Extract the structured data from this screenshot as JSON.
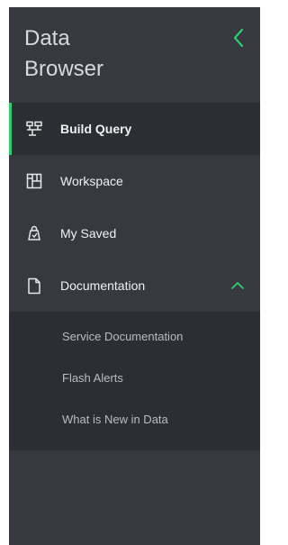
{
  "app": {
    "title": "Data Browser"
  },
  "colors": {
    "sidebar_bg": "#363a40",
    "active_bg": "#2b2e33",
    "accent": "#2ecc71"
  },
  "icons": {
    "collapse": "chevron-left-icon",
    "expand": "chevron-up-icon"
  },
  "nav": {
    "items": [
      {
        "label": "Build Query",
        "icon": "query-builder-icon",
        "active": true
      },
      {
        "label": "Workspace",
        "icon": "workspace-icon",
        "active": false
      },
      {
        "label": "My Saved",
        "icon": "saved-icon",
        "active": false
      },
      {
        "label": "Documentation",
        "icon": "document-icon",
        "active": false,
        "expanded": true
      }
    ],
    "submenu": [
      {
        "label": "Service Documentation"
      },
      {
        "label": "Flash Alerts"
      },
      {
        "label": "What is New in Data"
      }
    ]
  }
}
